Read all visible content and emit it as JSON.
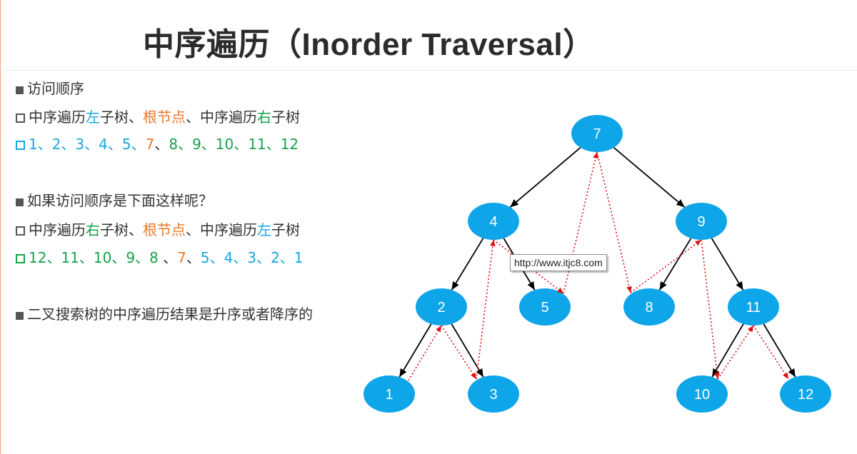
{
  "title": "中序遍历（Inorder Traversal）",
  "colors": {
    "blue": "#19a7e0",
    "orange": "#ea7a2c",
    "green": "#16a34a",
    "text": "#333333",
    "node_fill": "#0ea5e9",
    "traversal_arrow": "#dd1111"
  },
  "bullets": [
    {
      "marker": "filled-square",
      "marker_color": "#555555",
      "segments": [
        {
          "text": "访问顺序",
          "color": "gray"
        }
      ]
    },
    {
      "marker": "hollow-square",
      "marker_color": "#555555",
      "segments": [
        {
          "text": "中序遍历",
          "color": "gray"
        },
        {
          "text": "左",
          "color": "blue"
        },
        {
          "text": "子树、",
          "color": "gray"
        },
        {
          "text": "根节点",
          "color": "orange"
        },
        {
          "text": "、中序遍历",
          "color": "gray"
        },
        {
          "text": "右",
          "color": "green"
        },
        {
          "text": "子树",
          "color": "gray"
        }
      ]
    },
    {
      "marker": "hollow-square",
      "marker_color": "#19a7e0",
      "segments": [
        {
          "text": "1、2、3、4、5、",
          "color": "blue"
        },
        {
          "text": "7",
          "color": "orange"
        },
        {
          "text": "、",
          "color": "gray"
        },
        {
          "text": "8、9、10、11、12",
          "color": "green"
        }
      ]
    },
    {
      "marker": "filled-square",
      "marker_color": "#555555",
      "segments": [
        {
          "text": "如果访问顺序是下面这样呢？",
          "color": "gray"
        }
      ]
    },
    {
      "marker": "hollow-square",
      "marker_color": "#555555",
      "segments": [
        {
          "text": "中序遍历",
          "color": "gray"
        },
        {
          "text": "右",
          "color": "green"
        },
        {
          "text": "子树、",
          "color": "gray"
        },
        {
          "text": "根节点",
          "color": "orange"
        },
        {
          "text": "、中序遍历",
          "color": "gray"
        },
        {
          "text": "左",
          "color": "blue"
        },
        {
          "text": "子树",
          "color": "gray"
        }
      ]
    },
    {
      "marker": "hollow-square",
      "marker_color": "#16a34a",
      "segments": [
        {
          "text": "12、11、10、9、8",
          "color": "green"
        },
        {
          "text": " 、",
          "color": "gray"
        },
        {
          "text": "7",
          "color": "orange"
        },
        {
          "text": "、",
          "color": "gray"
        },
        {
          "text": "5、4、3、2、1",
          "color": "blue"
        }
      ]
    },
    {
      "marker": "filled-square",
      "marker_color": "#555555",
      "segments": [
        {
          "text": "二叉搜索树的中序遍历结果是升序或者降序的",
          "color": "gray"
        }
      ]
    }
  ],
  "tree": {
    "nodes": [
      {
        "id": "7",
        "label": "7"
      },
      {
        "id": "4",
        "label": "4"
      },
      {
        "id": "9",
        "label": "9"
      },
      {
        "id": "2",
        "label": "2"
      },
      {
        "id": "5",
        "label": "5"
      },
      {
        "id": "8",
        "label": "8"
      },
      {
        "id": "11",
        "label": "11"
      },
      {
        "id": "1",
        "label": "1"
      },
      {
        "id": "3",
        "label": "3"
      },
      {
        "id": "10",
        "label": "10"
      },
      {
        "id": "12",
        "label": "12"
      }
    ],
    "edges": [
      [
        "7",
        "4"
      ],
      [
        "7",
        "9"
      ],
      [
        "4",
        "2"
      ],
      [
        "4",
        "5"
      ],
      [
        "9",
        "8"
      ],
      [
        "9",
        "11"
      ],
      [
        "2",
        "1"
      ],
      [
        "2",
        "3"
      ],
      [
        "11",
        "10"
      ],
      [
        "11",
        "12"
      ]
    ],
    "traversal_path": [
      "1",
      "2",
      "3",
      "4",
      "5",
      "7",
      "8",
      "9",
      "10",
      "11",
      "12"
    ]
  },
  "tooltip": "http://www.itjc8.com"
}
